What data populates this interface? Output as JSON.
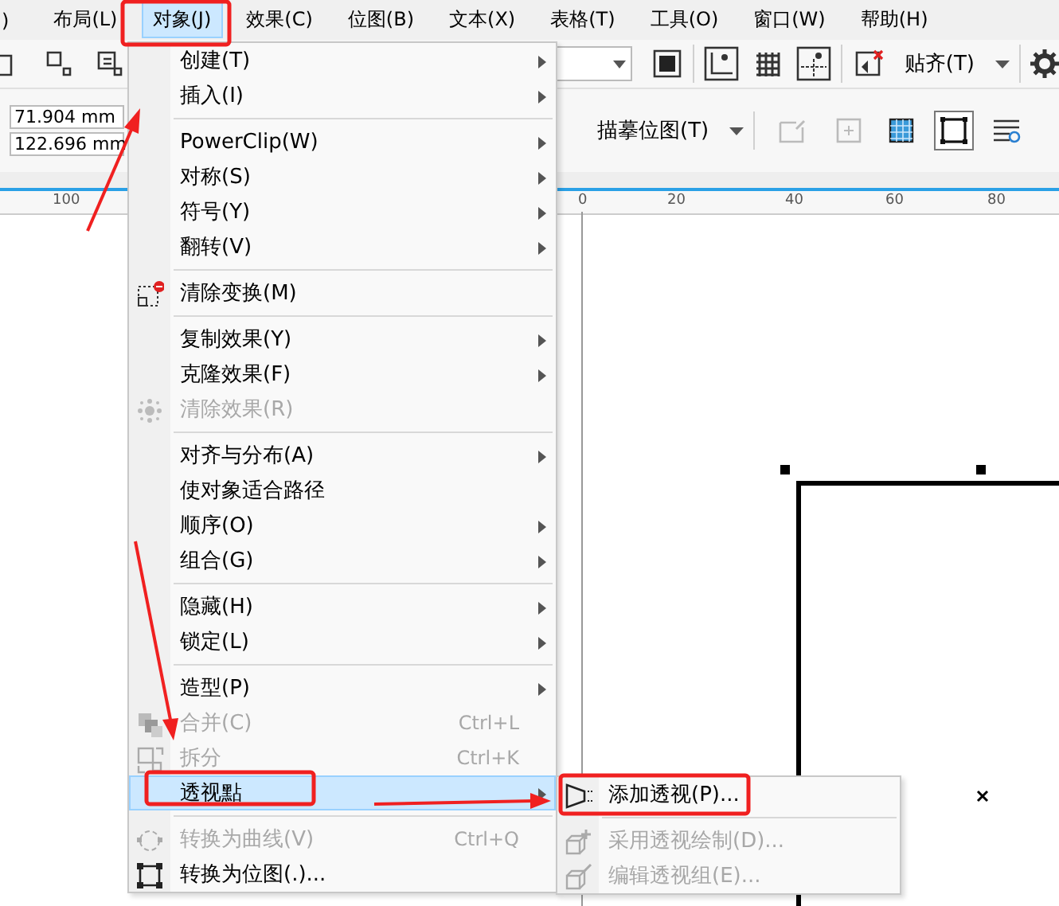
{
  "menubar": [
    {
      "label": ")",
      "selected": false
    },
    {
      "label": "布局(L)",
      "selected": false
    },
    {
      "label": "对象(J)",
      "selected": true
    },
    {
      "label": "效果(C)",
      "selected": false
    },
    {
      "label": "位图(B)",
      "selected": false
    },
    {
      "label": "文本(X)",
      "selected": false
    },
    {
      "label": "表格(T)",
      "selected": false
    },
    {
      "label": "工具(O)",
      "selected": false
    },
    {
      "label": "窗口(W)",
      "selected": false
    },
    {
      "label": "帮助(H)",
      "selected": false
    }
  ],
  "toolbar": {
    "snap_button": "贴齐(T)",
    "trace_button": "描摹位图(T)",
    "x_field": "71.904 mm",
    "y_field": "122.696 mm"
  },
  "ruler": {
    "labels": [
      "100",
      "0",
      "20",
      "40",
      "60",
      "80"
    ]
  },
  "menu": {
    "items": [
      {
        "kind": "item",
        "label": "创建(T)",
        "submenu": true,
        "disabled": false,
        "selected": false
      },
      {
        "kind": "item",
        "label": "插入(I)",
        "submenu": true,
        "disabled": false,
        "selected": false
      },
      {
        "kind": "separator"
      },
      {
        "kind": "item",
        "label": "PowerClip(W)",
        "submenu": true,
        "disabled": false,
        "selected": false
      },
      {
        "kind": "item",
        "label": "对称(S)",
        "submenu": true,
        "disabled": false,
        "selected": false
      },
      {
        "kind": "item",
        "label": "符号(Y)",
        "submenu": true,
        "disabled": false,
        "selected": false
      },
      {
        "kind": "item",
        "label": "翻转(V)",
        "submenu": true,
        "disabled": false,
        "selected": false
      },
      {
        "kind": "separator"
      },
      {
        "kind": "item",
        "label": "清除变换(M)",
        "icon": true,
        "submenu": false,
        "disabled": false,
        "selected": false
      },
      {
        "kind": "separator"
      },
      {
        "kind": "item",
        "label": "复制效果(Y)",
        "submenu": true,
        "disabled": false,
        "selected": false
      },
      {
        "kind": "item",
        "label": "克隆效果(F)",
        "submenu": true,
        "disabled": false,
        "selected": false
      },
      {
        "kind": "item",
        "label": "清除效果(R)",
        "icon": true,
        "submenu": false,
        "disabled": true,
        "selected": false
      },
      {
        "kind": "separator"
      },
      {
        "kind": "item",
        "label": "对齐与分布(A)",
        "submenu": true,
        "disabled": false,
        "selected": false
      },
      {
        "kind": "item",
        "label": "使对象适合路径",
        "submenu": false,
        "disabled": false,
        "selected": false
      },
      {
        "kind": "item",
        "label": "顺序(O)",
        "submenu": true,
        "disabled": false,
        "selected": false
      },
      {
        "kind": "item",
        "label": "组合(G)",
        "submenu": true,
        "disabled": false,
        "selected": false
      },
      {
        "kind": "separator"
      },
      {
        "kind": "item",
        "label": "隐藏(H)",
        "submenu": true,
        "disabled": false,
        "selected": false
      },
      {
        "kind": "item",
        "label": "锁定(L)",
        "submenu": true,
        "disabled": false,
        "selected": false
      },
      {
        "kind": "separator"
      },
      {
        "kind": "item",
        "label": "造型(P)",
        "submenu": true,
        "disabled": false,
        "selected": false
      },
      {
        "kind": "item",
        "label": "合并(C)",
        "icon": true,
        "shortcut": "Ctrl+L",
        "submenu": false,
        "disabled": true,
        "selected": false
      },
      {
        "kind": "item",
        "label": "拆分",
        "icon": true,
        "shortcut": "Ctrl+K",
        "submenu": false,
        "disabled": true,
        "selected": false
      },
      {
        "kind": "item",
        "label": "透视點",
        "submenu": true,
        "disabled": false,
        "selected": true
      },
      {
        "kind": "separator"
      },
      {
        "kind": "item",
        "label": "转换为曲线(V)",
        "icon": true,
        "shortcut": "Ctrl+Q",
        "submenu": false,
        "disabled": true,
        "selected": false
      },
      {
        "kind": "item",
        "label": "转换为位图(.)...",
        "icon": true,
        "submenu": false,
        "disabled": false,
        "selected": false
      }
    ]
  },
  "submenu": {
    "items": [
      {
        "kind": "item",
        "label": "添加透视(P)...",
        "icon": true,
        "disabled": false
      },
      {
        "kind": "separator"
      },
      {
        "kind": "item",
        "label": "采用透视绘制(D)...",
        "icon": true,
        "disabled": true
      },
      {
        "kind": "item",
        "label": "编辑透视组(E)...",
        "icon": true,
        "disabled": true
      }
    ]
  }
}
